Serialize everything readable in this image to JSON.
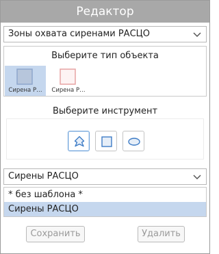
{
  "window": {
    "title": "Редактор"
  },
  "layer_select": {
    "value": "Зоны охвата сиренами РАСЦО"
  },
  "object_type": {
    "title": "Выберите тип объекта",
    "items": [
      {
        "label": "Сирена Р…",
        "selected": true,
        "stroke": "#8ea6cc",
        "fill": "#b7c6dc"
      },
      {
        "label": "Сирена Р…",
        "selected": false,
        "stroke": "#e7a3a3",
        "fill": "#fdf3f3"
      }
    ]
  },
  "tools": {
    "title": "Выберите инструмент",
    "items": [
      {
        "icon": "pin-icon",
        "active": true
      },
      {
        "icon": "square-icon",
        "active": false
      },
      {
        "icon": "ellipse-icon",
        "active": false
      }
    ]
  },
  "template_select": {
    "value": "Сирены РАСЦО",
    "options": [
      "* без шаблона *",
      "Сирены РАСЦО"
    ],
    "selected_index": 1
  },
  "buttons": {
    "save": "Сохранить",
    "delete": "Удалить"
  },
  "colors": {
    "titlebar": "#a8a8a8",
    "selection": "#c5d7ee",
    "tool_icon": "#3e7cc6"
  }
}
